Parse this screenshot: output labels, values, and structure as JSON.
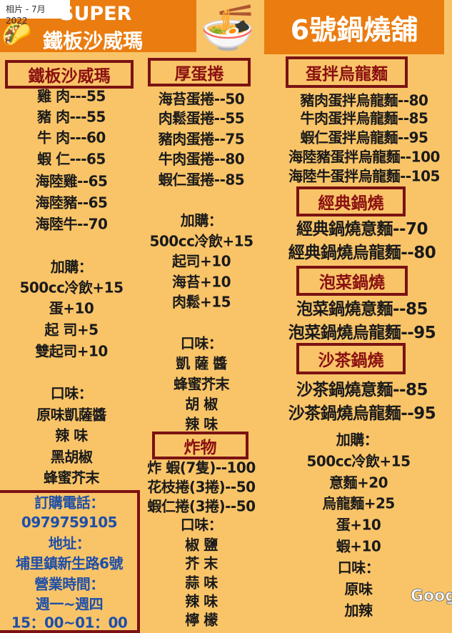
{
  "viewer": {
    "photo_date_chip": "相片 - 7月 2022",
    "google_logo": "Goog"
  },
  "banner_left": {
    "line1": "SUPER",
    "line2": "鐵板沙威瑪",
    "icon": "taco-icon"
  },
  "banner_center_icon": "noodle-bowl-icon",
  "banner_right": {
    "title": "6號鍋燒舖"
  },
  "left_column": {
    "header": "鐵板沙威瑪",
    "items": [
      "雞 肉---55",
      "豬 肉---55",
      "牛 肉---60",
      "蝦 仁---65",
      "海陸雞--65",
      "海陸豬--65",
      "海陸牛--70"
    ],
    "addons_title": "加購：",
    "addons": [
      "500cc冷飲+15",
      "蛋+10",
      "起 司+5",
      "雙起司+10"
    ],
    "flavors_title": "口味：",
    "flavors": [
      "原味凱薩醬",
      "辣 味",
      "黑胡椒",
      "蜂蜜芥末"
    ],
    "contact": [
      "訂購電話：",
      "0979759105",
      "地址：",
      "埔里鎮新生路6號",
      "營業時間：",
      "週一~週四",
      "15：00~01：00"
    ]
  },
  "middle_column": {
    "header": "厚蛋捲",
    "items": [
      "海苔蛋捲--50",
      "肉鬆蛋捲--55",
      "豬肉蛋捲--75",
      "牛肉蛋捲--80",
      "蝦仁蛋捲--85"
    ],
    "addons_title": "加購：",
    "addons": [
      "500cc冷飲+15",
      "起司+10",
      "海苔+10",
      "肉鬆+15"
    ],
    "flavors_title": "口味：",
    "flavors": [
      "凱 薩 醬",
      "蜂蜜芥末",
      "胡 椒",
      "辣 味"
    ],
    "fried_header": "炸物",
    "fried_items": [
      "炸 蝦(7隻)--100",
      "花枝捲(3捲)--50",
      "蝦仁捲(3捲)--50"
    ],
    "fried_flavors_title": "口味：",
    "fried_flavors": [
      "椒 鹽",
      "芥 末",
      "蒜 味",
      "辣 味",
      "檸 檬"
    ]
  },
  "right_column": {
    "header": "蛋拌烏龍麵",
    "items": [
      "豬肉蛋拌烏龍麵--80",
      "牛肉蛋拌烏龍麵--85",
      "蝦仁蛋拌烏龍麵--95",
      "海陸豬蛋拌烏龍麵--100",
      "海陸牛蛋拌烏龍麵--105"
    ],
    "classic_header": "經典鍋燒",
    "classic_items": [
      "經典鍋燒意麵--70",
      "經典鍋燒烏龍麵--80"
    ],
    "kimchi_header": "泡菜鍋燒",
    "kimchi_items": [
      "泡菜鍋燒意麵--85",
      "泡菜鍋燒烏龍麵--95"
    ],
    "satay_header": "沙茶鍋燒",
    "satay_items": [
      "沙茶鍋燒意麵--85",
      "沙茶鍋燒烏龍麵--95"
    ],
    "addons_title": "加購：",
    "addons": [
      "500cc冷飲+15",
      "意麵+20",
      "烏龍麵+25",
      "蛋+10",
      "蝦+10"
    ],
    "flavors_title": "口味：",
    "flavors": [
      "原味",
      "加辣"
    ]
  },
  "colors": {
    "background": "#f9c468",
    "banner": "#ea7c10",
    "header_border": "#7a1212",
    "header_text": "#8a1010",
    "contact_text": "#1f4fa8"
  }
}
